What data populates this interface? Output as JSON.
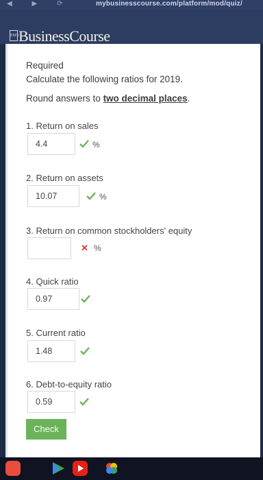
{
  "browser": {
    "url": "mybusinesscourse.com/platform/mod/quiz/"
  },
  "header": {
    "brand": "BusinessCourse",
    "logo_text": "EMY"
  },
  "instructions": {
    "line1": "Required",
    "line2": "Calculate the following ratios for 2019.",
    "line3_prefix": "Round answers to ",
    "line3_bold": "two decimal places",
    "line3_suffix": "."
  },
  "questions": [
    {
      "label": "1. Return on sales",
      "value": "4.4",
      "unit": "%",
      "status": "correct"
    },
    {
      "label": "2. Return on assets",
      "value": "10.07",
      "unit": "%",
      "status": "correct"
    },
    {
      "label": "3. Return on common stockholders' equity",
      "value": "",
      "unit": "%",
      "status": "incorrect"
    },
    {
      "label": "4. Quick ratio",
      "value": "0.97",
      "unit": "",
      "status": "correct"
    },
    {
      "label": "5. Current ratio",
      "value": "1.48",
      "unit": "",
      "status": "correct"
    },
    {
      "label": "6. Debt-to-equity ratio",
      "value": "0.59",
      "unit": "",
      "status": "correct"
    }
  ],
  "actions": {
    "check_label": "Check"
  },
  "colors": {
    "accent_green": "#6bb25a",
    "error_red": "#dd3333",
    "brand_bar": "#2d3d61"
  },
  "dock": {
    "apps": [
      "app-icon-1",
      "play-store-icon",
      "youtube-icon",
      "photos-icon"
    ]
  }
}
